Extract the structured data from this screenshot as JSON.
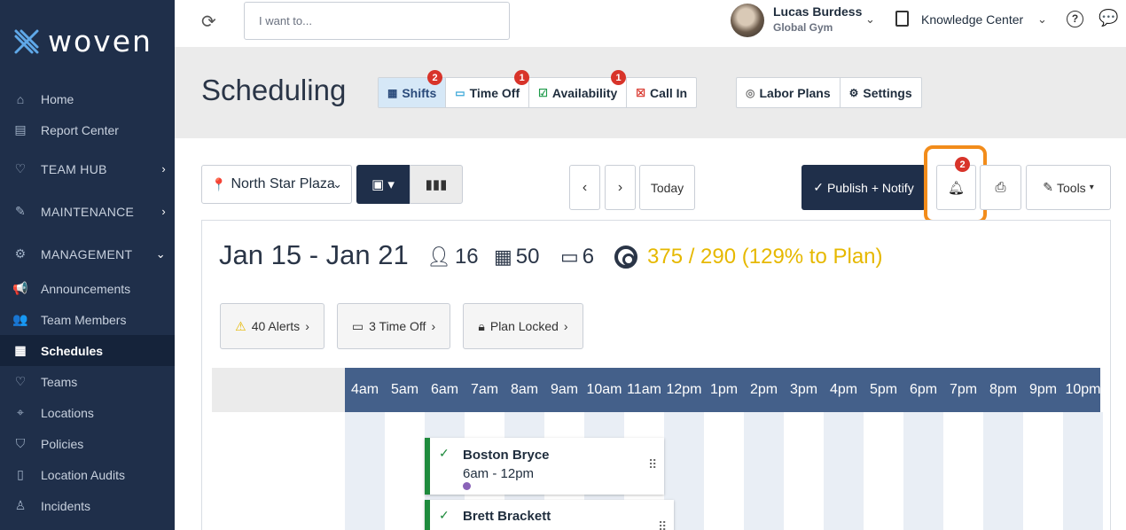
{
  "app": {
    "logo_text": "woven"
  },
  "sidebar": {
    "items": [
      {
        "label": "Home",
        "icon": "home-icon"
      },
      {
        "label": "Report Center",
        "icon": "document-icon"
      },
      {
        "label": "TEAM HUB",
        "icon": "heart-icon",
        "section": true
      },
      {
        "label": "MAINTENANCE",
        "icon": "wrench-icon",
        "section": true
      },
      {
        "label": "MANAGEMENT",
        "icon": "gears-icon",
        "section": true,
        "expanded": true
      },
      {
        "label": "Announcements",
        "icon": "megaphone-icon"
      },
      {
        "label": "Team Members",
        "icon": "users-icon"
      },
      {
        "label": "Schedules",
        "icon": "calendar-icon",
        "active": true
      },
      {
        "label": "Teams",
        "icon": "heart-icon"
      },
      {
        "label": "Locations",
        "icon": "pin-icon"
      },
      {
        "label": "Policies",
        "icon": "shield-icon"
      },
      {
        "label": "Location Audits",
        "icon": "clipboard-icon"
      },
      {
        "label": "Incidents",
        "icon": "person-alert-icon"
      }
    ]
  },
  "topbar": {
    "search_placeholder": "I want to...",
    "user": {
      "name": "Lucas Burdess",
      "org": "Global Gym"
    },
    "knowledge_center": "Knowledge Center"
  },
  "header": {
    "title": "Scheduling",
    "tabs": [
      {
        "label": "Shifts",
        "badge": "2",
        "active": true
      },
      {
        "label": "Time Off",
        "badge": "1"
      },
      {
        "label": "Availability",
        "badge": "1"
      },
      {
        "label": "Call In",
        "badge": ""
      }
    ],
    "secondary_tabs": [
      {
        "label": "Labor Plans"
      },
      {
        "label": "Settings"
      }
    ]
  },
  "toolbar": {
    "location": "North Star Plaza",
    "today": "Today",
    "publish": "Publish + Notify",
    "notifications_badge": "2",
    "tools": "Tools"
  },
  "summary": {
    "date_range": "Jan 15 - Jan 21",
    "people": "16",
    "shifts": "50",
    "days": "6",
    "plan": "375 / 290 (129% to Plan)"
  },
  "chips": {
    "alerts": "40 Alerts",
    "time_off": "3 Time Off",
    "plan_locked": "Plan Locked"
  },
  "timeline": {
    "hours": [
      "4am",
      "5am",
      "6am",
      "7am",
      "8am",
      "9am",
      "10am",
      "11am",
      "12pm",
      "1pm",
      "2pm",
      "3pm",
      "4pm",
      "5pm",
      "6pm",
      "7pm",
      "8pm",
      "9pm",
      "10pm"
    ]
  },
  "shifts": [
    {
      "name": "Boston Bryce",
      "time": "6am - 12pm"
    },
    {
      "name": "Brett Brackett",
      "time": ""
    }
  ],
  "colors": {
    "sidebar": "#1f2f4a",
    "accent_highlight": "#f28c1b",
    "badge": "#d8342a",
    "plan_text": "#e6b800",
    "timeline_header": "#44608a"
  }
}
